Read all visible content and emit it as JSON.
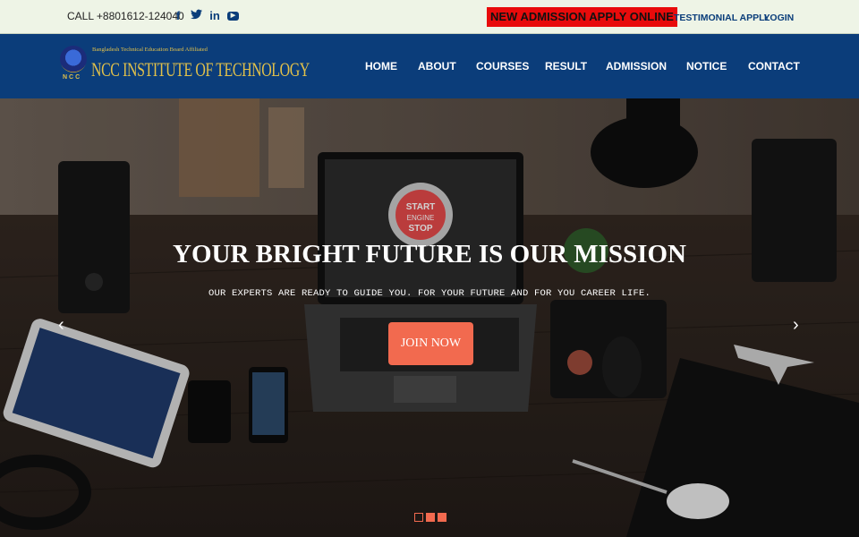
{
  "topbar": {
    "call": "CALL +8801612-124040",
    "apply_online": "NEW ADMISSION APPLY ONLINE",
    "testimonial": "TESTIMONIAL APPLY",
    "login": "LOGIN",
    "social_icons": [
      "facebook-icon",
      "twitter-icon",
      "linkedin-icon",
      "youtube-icon"
    ]
  },
  "logo": {
    "subtitle": "Bangladesh Technical Education Board Affiliated",
    "title": "NCC INSTITUTE OF TECHNOLOGY",
    "emblem_text": "NCC"
  },
  "nav": {
    "items": [
      "HOME",
      "ABOUT",
      "COURSES",
      "RESULT",
      "ADMISSION",
      "NOTICE",
      "CONTACT"
    ]
  },
  "hero": {
    "title": "YOUR BRIGHT FUTURE IS OUR MISSION",
    "subtitle": "OUR EXPERTS ARE READY TO GUIDE YOU. FOR YOUR FUTURE AND FOR YOU CAREER LIFE.",
    "button": "JOIN NOW",
    "laptop_screen_text": [
      "START",
      "ENGINE",
      "STOP"
    ],
    "slides_total": 3,
    "active_slide": 1
  },
  "colors": {
    "topbar_bg": "#eef4e6",
    "header_bg": "#0b3d7a",
    "accent_red": "#e80b0b",
    "join_orange": "#f26a4f",
    "logo_gold": "#e2c14a"
  }
}
